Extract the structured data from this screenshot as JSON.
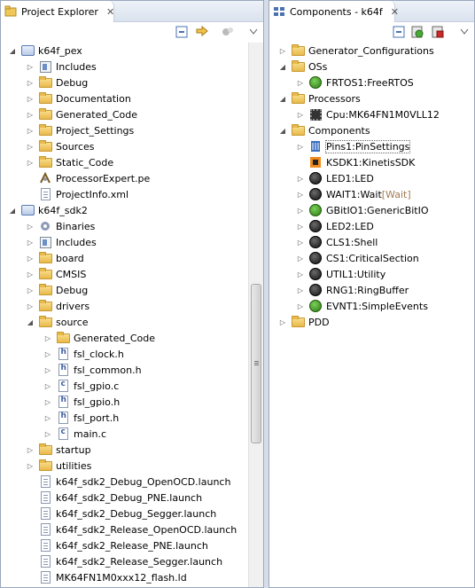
{
  "left_panel": {
    "title": "Project Explorer",
    "close": "✕",
    "tree": [
      {
        "label": "k64f_pex",
        "icon": "project-icon",
        "twisty": "open",
        "indent": 0
      },
      {
        "label": "Includes",
        "icon": "includes-icon",
        "twisty": "closed",
        "indent": 1
      },
      {
        "label": "Debug",
        "icon": "folder-icon",
        "twisty": "closed",
        "indent": 1
      },
      {
        "label": "Documentation",
        "icon": "folder-icon",
        "twisty": "closed",
        "indent": 1
      },
      {
        "label": "Generated_Code",
        "icon": "folder-icon",
        "twisty": "closed",
        "indent": 1
      },
      {
        "label": "Project_Settings",
        "icon": "folder-icon",
        "twisty": "closed",
        "indent": 1
      },
      {
        "label": "Sources",
        "icon": "folder-icon",
        "twisty": "closed",
        "indent": 1
      },
      {
        "label": "Static_Code",
        "icon": "folder-icon",
        "twisty": "closed",
        "indent": 1
      },
      {
        "label": "ProcessorExpert.pe",
        "icon": "pe-file-icon",
        "twisty": "none",
        "indent": 1
      },
      {
        "label": "ProjectInfo.xml",
        "icon": "xml-file-icon",
        "twisty": "none",
        "indent": 1
      },
      {
        "label": "k64f_sdk2",
        "icon": "project-icon",
        "twisty": "open",
        "indent": 0
      },
      {
        "label": "Binaries",
        "icon": "binaries-icon",
        "twisty": "closed",
        "indent": 1
      },
      {
        "label": "Includes",
        "icon": "includes-icon",
        "twisty": "closed",
        "indent": 1
      },
      {
        "label": "board",
        "icon": "folder-icon",
        "twisty": "closed",
        "indent": 1
      },
      {
        "label": "CMSIS",
        "icon": "folder-icon",
        "twisty": "closed",
        "indent": 1
      },
      {
        "label": "Debug",
        "icon": "folder-icon",
        "twisty": "closed",
        "indent": 1
      },
      {
        "label": "drivers",
        "icon": "folder-icon",
        "twisty": "closed",
        "indent": 1
      },
      {
        "label": "source",
        "icon": "folder-icon",
        "twisty": "open",
        "indent": 1
      },
      {
        "label": "Generated_Code",
        "icon": "folder-icon",
        "twisty": "closed",
        "indent": 2
      },
      {
        "label": "fsl_clock.h",
        "icon": "h-file-icon",
        "twisty": "closed",
        "indent": 2
      },
      {
        "label": "fsl_common.h",
        "icon": "h-file-icon",
        "twisty": "closed",
        "indent": 2
      },
      {
        "label": "fsl_gpio.c",
        "icon": "c-file-icon",
        "twisty": "closed",
        "indent": 2
      },
      {
        "label": "fsl_gpio.h",
        "icon": "h-file-icon",
        "twisty": "closed",
        "indent": 2
      },
      {
        "label": "fsl_port.h",
        "icon": "h-file-icon",
        "twisty": "closed",
        "indent": 2
      },
      {
        "label": "main.c",
        "icon": "c-file-icon",
        "twisty": "closed",
        "indent": 2
      },
      {
        "label": "startup",
        "icon": "folder-icon",
        "twisty": "closed",
        "indent": 1
      },
      {
        "label": "utilities",
        "icon": "folder-icon",
        "twisty": "closed",
        "indent": 1
      },
      {
        "label": "k64f_sdk2_Debug_OpenOCD.launch",
        "icon": "launch-file-icon",
        "twisty": "none",
        "indent": 1
      },
      {
        "label": "k64f_sdk2_Debug_PNE.launch",
        "icon": "launch-file-icon",
        "twisty": "none",
        "indent": 1
      },
      {
        "label": "k64f_sdk2_Debug_Segger.launch",
        "icon": "launch-file-icon",
        "twisty": "none",
        "indent": 1
      },
      {
        "label": "k64f_sdk2_Release_OpenOCD.launch",
        "icon": "launch-file-icon",
        "twisty": "none",
        "indent": 1
      },
      {
        "label": "k64f_sdk2_Release_PNE.launch",
        "icon": "launch-file-icon",
        "twisty": "none",
        "indent": 1
      },
      {
        "label": "k64f_sdk2_Release_Segger.launch",
        "icon": "launch-file-icon",
        "twisty": "none",
        "indent": 1
      },
      {
        "label": "MK64FN1M0xxx12_flash.ld",
        "icon": "launch-file-icon",
        "twisty": "none",
        "indent": 1
      }
    ]
  },
  "right_panel": {
    "title": "Components - k64f",
    "close": "✕",
    "tree": [
      {
        "label": "Generator_Configurations",
        "icon": "folder-icon",
        "twisty": "closed",
        "indent": 0
      },
      {
        "label": "OSs",
        "icon": "folder-icon",
        "twisty": "open",
        "indent": 0
      },
      {
        "label": "FRTOS1:FreeRTOS",
        "icon": "freertos-icon",
        "twisty": "closed",
        "indent": 1
      },
      {
        "label": "Processors",
        "icon": "folder-icon",
        "twisty": "open",
        "indent": 0
      },
      {
        "label": "Cpu:MK64FN1M0VLL12",
        "icon": "cpu-icon",
        "twisty": "closed",
        "indent": 1
      },
      {
        "label": "Components",
        "icon": "folder-icon",
        "twisty": "open",
        "indent": 0
      },
      {
        "label": "Pins1:PinSettings",
        "icon": "pins-icon",
        "twisty": "closed",
        "indent": 1,
        "selected": true
      },
      {
        "label": "KSDK1:KinetisSDK",
        "icon": "ksdk-icon",
        "twisty": "none",
        "indent": 1
      },
      {
        "label": "LED1:LED",
        "icon": "led-icon",
        "twisty": "closed",
        "indent": 1
      },
      {
        "label": "WAIT1:Wait",
        "suffix": "[Wait]",
        "icon": "wait-icon",
        "twisty": "closed",
        "indent": 1
      },
      {
        "label": "GBitIO1:GenericBitIO",
        "icon": "bitio-icon",
        "twisty": "closed",
        "indent": 1
      },
      {
        "label": "LED2:LED",
        "icon": "led-icon",
        "twisty": "closed",
        "indent": 1
      },
      {
        "label": "CLS1:Shell",
        "icon": "shell-icon",
        "twisty": "closed",
        "indent": 1
      },
      {
        "label": "CS1:CriticalSection",
        "icon": "critical-section-icon",
        "twisty": "closed",
        "indent": 1
      },
      {
        "label": "UTIL1:Utility",
        "icon": "utility-icon",
        "twisty": "closed",
        "indent": 1
      },
      {
        "label": "RNG1:RingBuffer",
        "icon": "ringbuffer-icon",
        "twisty": "closed",
        "indent": 1
      },
      {
        "label": "EVNT1:SimpleEvents",
        "icon": "events-icon",
        "twisty": "closed",
        "indent": 1
      },
      {
        "label": "PDD",
        "icon": "folder-icon",
        "twisty": "closed",
        "indent": 0
      }
    ]
  }
}
